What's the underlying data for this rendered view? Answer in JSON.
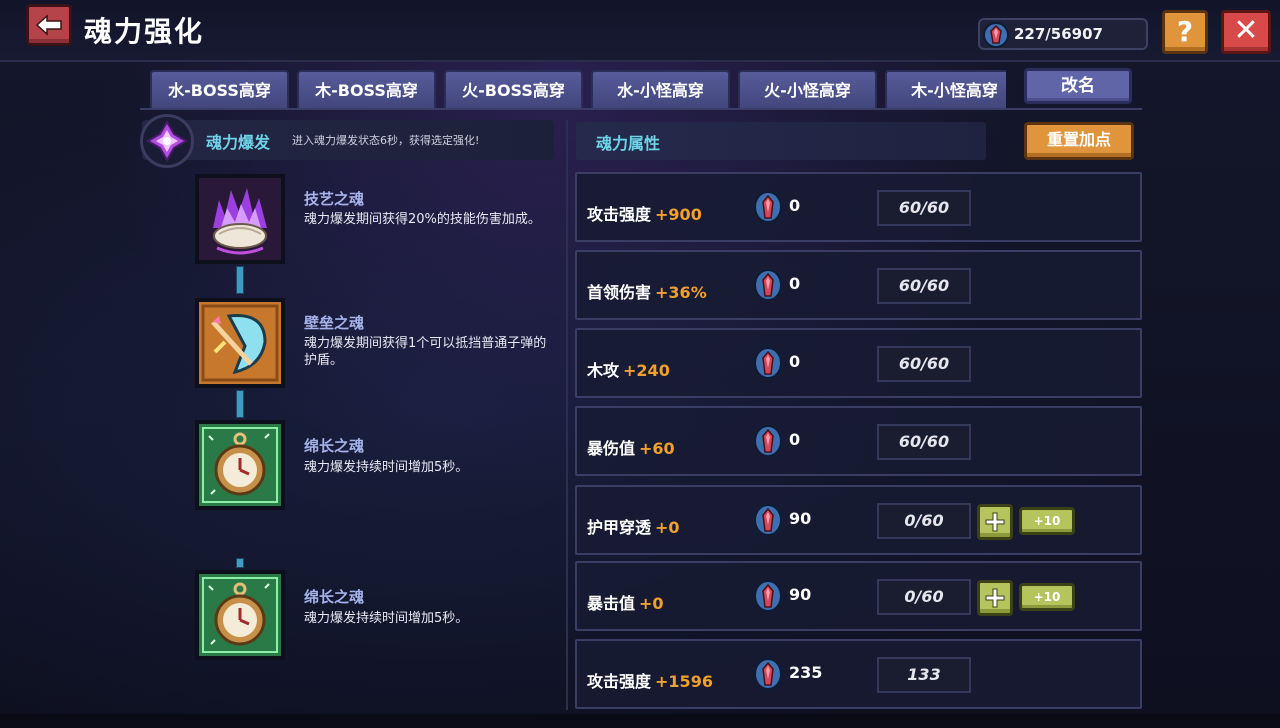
{
  "header": {
    "title": "魂力强化",
    "currency": "227/56907",
    "help_label": "?",
    "close_label": "✕"
  },
  "tabs": [
    {
      "label": "水-BOSS高穿"
    },
    {
      "label": "木-BOSS高穿"
    },
    {
      "label": "火-BOSS高穿"
    },
    {
      "label": "水-小怪高穿"
    },
    {
      "label": "火-小怪高穿"
    },
    {
      "label": "木-小怪高穿"
    }
  ],
  "rename_label": "改名",
  "burst": {
    "title": "魂力爆发",
    "desc": "进入魂力爆发状态6秒，获得选定强化!"
  },
  "skills": [
    {
      "name": "技艺之魂",
      "desc": "魂力爆发期间获得20%的技能伤害加成。"
    },
    {
      "name": "壁垒之魂",
      "desc": "魂力爆发期间获得1个可以抵挡普通子弹的护盾。"
    },
    {
      "name": "绵长之魂",
      "desc": "魂力爆发持续时间增加5秒。"
    },
    {
      "name": "绵长之魂",
      "desc": "魂力爆发持续时间增加5秒。"
    }
  ],
  "attributes": {
    "header": "魂力属性",
    "reset_label": "重置加点",
    "plus10_label": "+10",
    "rows": [
      {
        "name": "攻击强度",
        "bonus": "+900",
        "cost": "0",
        "progress": "60/60"
      },
      {
        "name": "首领伤害",
        "bonus": "+36%",
        "cost": "0",
        "progress": "60/60"
      },
      {
        "name": "木攻",
        "bonus": "+240",
        "cost": "0",
        "progress": "60/60"
      },
      {
        "name": "暴伤值",
        "bonus": "+60",
        "cost": "0",
        "progress": "60/60"
      },
      {
        "name": "护甲穿透",
        "bonus": "+0",
        "cost": "90",
        "progress": "0/60"
      },
      {
        "name": "暴击值",
        "bonus": "+0",
        "cost": "90",
        "progress": "0/60"
      },
      {
        "name": "攻击强度",
        "bonus": "+1596",
        "cost": "235",
        "progress": "133"
      }
    ]
  },
  "colors": {
    "accent_cyan": "#6fd3e8",
    "bonus_orange": "#f0a02c",
    "tab_purple": "#575c9a",
    "button_orange": "#e0953c",
    "button_green": "#b5c45c",
    "close_red": "#d84a4a"
  },
  "icons": {
    "back": "arrow-left-icon",
    "currency": "soul-gem-icon",
    "burst": "purple-crystal-icon",
    "skill1": "purple-flame-shell-icon",
    "skill2": "shield-boomerang-icon",
    "skill3": "pocket-watch-icon",
    "skill4": "pocket-watch-icon"
  }
}
